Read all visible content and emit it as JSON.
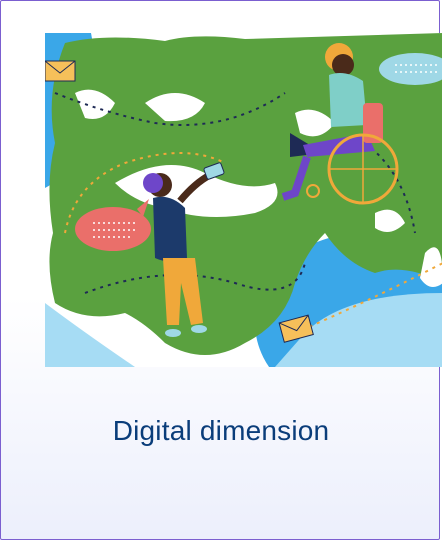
{
  "card": {
    "title": "Digital dimension",
    "accent_color": "#7b5fd0",
    "title_color": "#0a3d7a"
  },
  "illustration": {
    "icons": [
      "world-map",
      "envelope-icon",
      "speech-bubble-icon",
      "person-with-tablet",
      "person-in-wheelchair-with-laptop"
    ]
  }
}
